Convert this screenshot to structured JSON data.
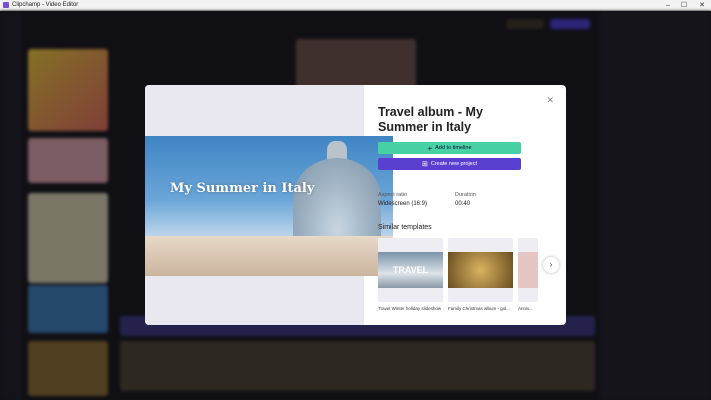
{
  "window": {
    "title": "Clipchamp - Video Editor",
    "minimize": "–",
    "maximize": "☐",
    "close": "✕"
  },
  "modal": {
    "preview_text": "My Summer in Italy",
    "title": "Travel album - My Summer in Italy",
    "close_icon": "✕",
    "add_button": "Add to timeline",
    "add_icon": "+",
    "create_button": "Create new project",
    "create_icon": "⊞",
    "aspect_label": "Aspect ratio",
    "aspect_value": "Widescreen (16:9)",
    "duration_label": "Duration",
    "duration_value": "00:40",
    "similar_heading": "Similar templates",
    "templates": [
      {
        "label": "Travel Winter holiday slideshow",
        "thumb_text": "TRAVEL"
      },
      {
        "label": "Family Christmas album - gol..."
      },
      {
        "label": "Anniv..."
      }
    ],
    "next_icon": "›"
  },
  "colors": {
    "add": "#47d1a4",
    "create": "#5b3fd1"
  }
}
